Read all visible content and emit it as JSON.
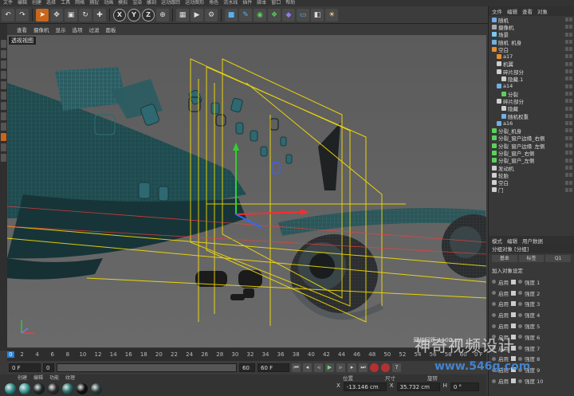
{
  "menubar": [
    "文件",
    "编辑",
    "创建",
    "选择",
    "工具",
    "网格",
    "捕捉",
    "动画",
    "模拟",
    "渲染",
    "雕刻",
    "运动跟踪",
    "运动图形",
    "角色",
    "流水线",
    "插件",
    "脚本",
    "窗口",
    "帮助"
  ],
  "toolbar": {
    "axis_x": "X",
    "axis_y": "Y",
    "axis_z": "Z"
  },
  "viewport": {
    "menu": [
      "查看",
      "摄像机",
      "显示",
      "选项",
      "过滤",
      "面板"
    ],
    "label": "透视视图",
    "grid_label": "网格间距：100 cm"
  },
  "timeline": {
    "frames": [
      "0",
      "2",
      "4",
      "6",
      "8",
      "10",
      "12",
      "14",
      "16",
      "18",
      "20",
      "22",
      "24",
      "26",
      "28",
      "30",
      "32",
      "34",
      "36",
      "38",
      "40",
      "42",
      "44",
      "46",
      "48",
      "50",
      "52",
      "54",
      "56",
      "58",
      "60"
    ],
    "current_frame": "0",
    "end_label": "0 F"
  },
  "transport": {
    "start": "0 F",
    "range_start": "0 F",
    "range_end": "60 F",
    "end": "60 F"
  },
  "materials": {
    "menu": [
      "创建",
      "编辑",
      "功能",
      "纹理"
    ],
    "colors": [
      "#2f8f8a",
      "#3a9d96",
      "#1a2a2a",
      "#2c2c2c",
      "#2a6f6b",
      "#111",
      "#2d3f3f"
    ]
  },
  "coords": {
    "headers": [
      "位置",
      "尺寸",
      "旋转"
    ],
    "x_label": "X",
    "x_pos": "-13.146 cm",
    "x_size": "35.732 cm",
    "h_label": "H",
    "h_rot": "0 °"
  },
  "objects": {
    "tabs": [
      "文件",
      "编辑",
      "查看",
      "对象"
    ],
    "items": [
      {
        "label": "随机",
        "color": "#6fb0e8",
        "indent": 0
      },
      {
        "label": "摄像机",
        "color": "#aaa",
        "indent": 0
      },
      {
        "label": "场景",
        "color": "#7bc8f0",
        "indent": 0
      },
      {
        "label": "随机_机身",
        "color": "#6fb0e8",
        "indent": 0
      },
      {
        "label": "空白",
        "color": "#e88d2c",
        "indent": 0
      },
      {
        "label": "a17",
        "color": "#e88d2c",
        "indent": 1
      },
      {
        "label": "机翼",
        "color": "#cfcfcf",
        "indent": 1
      },
      {
        "label": "碎片部分",
        "color": "#cfcfcf",
        "indent": 1
      },
      {
        "label": "隐藏.1",
        "color": "#cfcfcf",
        "indent": 2
      },
      {
        "label": "a14",
        "color": "#6fb0e8",
        "indent": 1
      },
      {
        "label": "分裂",
        "color": "#5ad15a",
        "indent": 2
      },
      {
        "label": "碎片部分",
        "color": "#cfcfcf",
        "indent": 1
      },
      {
        "label": "隐藏",
        "color": "#cfcfcf",
        "indent": 2
      },
      {
        "label": "随机权重",
        "color": "#6fb0e8",
        "indent": 2
      },
      {
        "label": "a16",
        "color": "#6fb0e8",
        "indent": 1
      },
      {
        "label": "分裂_机身",
        "color": "#5ad15a",
        "indent": 0
      },
      {
        "label": "分裂_窗户边缘_右侧",
        "color": "#5ad15a",
        "indent": 0
      },
      {
        "label": "分裂_窗户边缘_左侧",
        "color": "#5ad15a",
        "indent": 0
      },
      {
        "label": "分裂_窗户_右侧",
        "color": "#5ad15a",
        "indent": 0
      },
      {
        "label": "分裂_窗户_左侧",
        "color": "#5ad15a",
        "indent": 0
      },
      {
        "label": "发动机",
        "color": "#cfcfcf",
        "indent": 0
      },
      {
        "label": "轮胎",
        "color": "#cfcfcf",
        "indent": 0
      },
      {
        "label": "空白",
        "color": "#cfcfcf",
        "indent": 0
      },
      {
        "label": "门",
        "color": "#cfcfcf",
        "indent": 0
      }
    ]
  },
  "attributes": {
    "tabs": [
      "模式",
      "编辑",
      "用户数据"
    ],
    "title": "分组对象 [分组]",
    "subtabs": [
      "基本",
      "标签",
      "Q1"
    ],
    "section": "加入对象设定",
    "rows": [
      {
        "label": "启用",
        "value": "强度 1"
      },
      {
        "label": "启用",
        "value": "强度 2"
      },
      {
        "label": "启用",
        "value": "强度 3"
      },
      {
        "label": "启用",
        "value": "强度 4"
      },
      {
        "label": "启用",
        "value": "强度 5"
      },
      {
        "label": "启用",
        "value": "强度 6"
      },
      {
        "label": "启用",
        "value": "强度 7"
      },
      {
        "label": "启用",
        "value": "强度 8"
      },
      {
        "label": "启用",
        "value": "强度 9"
      },
      {
        "label": "启用",
        "value": "强度 10"
      }
    ]
  },
  "watermark": {
    "cn": "神奇视频设计",
    "url": "www.546g.com"
  }
}
